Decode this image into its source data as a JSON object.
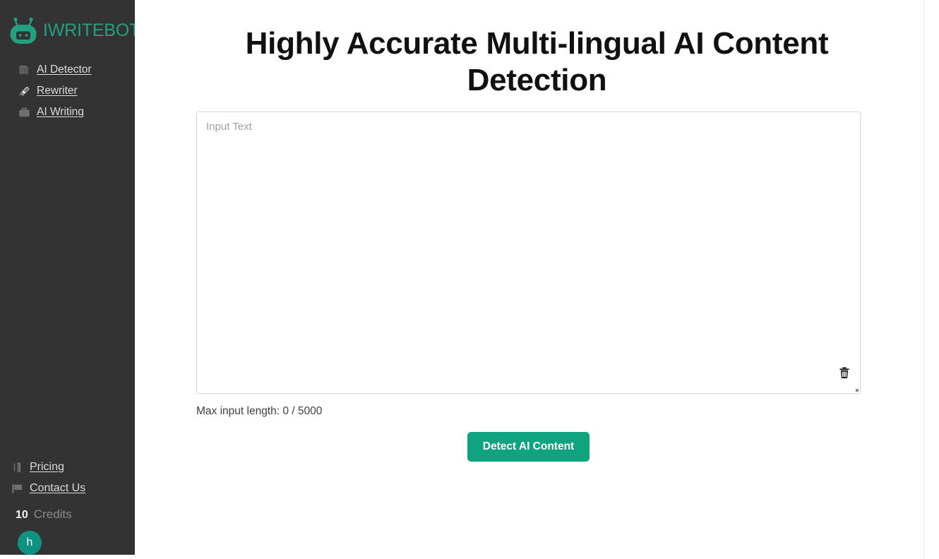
{
  "brand": {
    "logo_icon": "robot-head-icon",
    "name": "IWRITEBOT",
    "color": "#21a181"
  },
  "sidebar": {
    "background": "#333333",
    "nav_top": [
      {
        "label": "AI Detector",
        "icon": "wallet-icon"
      },
      {
        "label": "Rewriter",
        "icon": "pen-nib-icon"
      },
      {
        "label": "AI Writing",
        "icon": "briefcase-icon"
      }
    ],
    "nav_bottom": [
      {
        "label": "Pricing",
        "icon": "pen-ruler-icon"
      },
      {
        "label": "Contact Us",
        "icon": "flag-icon"
      }
    ],
    "credits": {
      "count": "10",
      "label": "Credits"
    },
    "avatar": {
      "initial": "h",
      "color": "#0e9383"
    }
  },
  "main": {
    "title": "Highly Accurate Multi-lingual AI Content Detection",
    "input": {
      "placeholder": "Input Text",
      "value": "",
      "clear_icon": "trash-icon"
    },
    "max_length_text": "Max input length: 0 / 5000",
    "detect_button": {
      "label": "Detect AI Content",
      "color": "#10a37f"
    }
  }
}
